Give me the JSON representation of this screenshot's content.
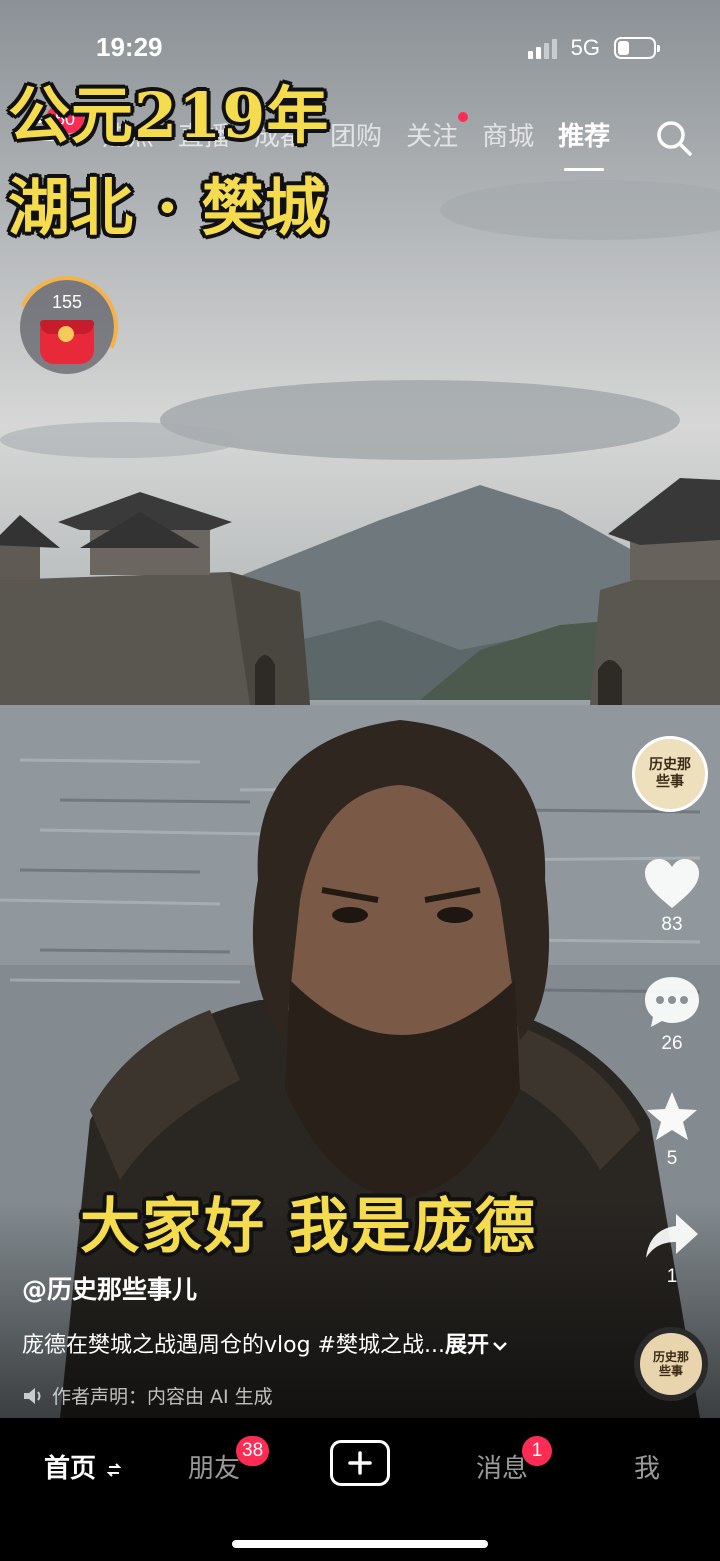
{
  "status_bar": {
    "time": "19:29",
    "network": "5G"
  },
  "top_nav": {
    "menu_badge": "50",
    "tabs": [
      {
        "label": "热点"
      },
      {
        "label": "直播"
      },
      {
        "label": "成都"
      },
      {
        "label": "团购"
      },
      {
        "label": "关注"
      },
      {
        "label": "商城"
      },
      {
        "label": "推荐"
      }
    ],
    "active_tab": "推荐",
    "dot_tab": "关注"
  },
  "overlay": {
    "line1": "公元219年",
    "line2": "湖北 · 樊城",
    "subtitle": "大家好 我是庞德"
  },
  "red_packet": {
    "count": "155"
  },
  "video": {
    "author": "@历史那些事儿",
    "description": "庞德在樊城之战遇周仓的vlog #樊城之战...",
    "expand": "展开",
    "disclaimer": "作者声明：内容由 AI 生成"
  },
  "actions": {
    "avatar_text": "历史那些事",
    "likes": "83",
    "comments": "26",
    "favorites": "5",
    "shares": "1",
    "music_text": "历史那些事"
  },
  "tab_bar": {
    "home": "首页",
    "friends": "朋友",
    "friends_badge": "38",
    "messages": "消息",
    "messages_badge": "1",
    "me": "我"
  },
  "colors": {
    "accent": "#fe2c55",
    "caption_yellow": "#f5dc4f"
  }
}
